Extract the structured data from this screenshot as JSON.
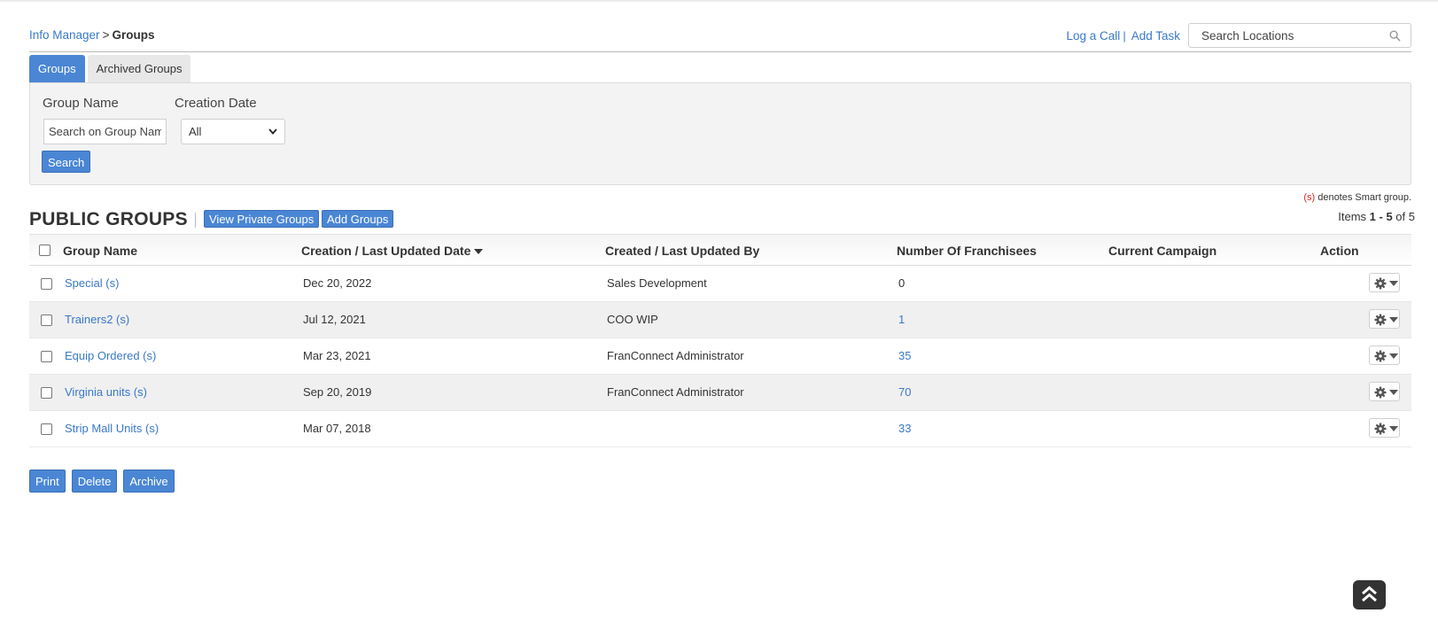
{
  "breadcrumb": {
    "parent": "Info Manager",
    "separator": ">",
    "current": "Groups"
  },
  "header_links": {
    "log_call": "Log a Call",
    "add_task": "Add Task",
    "pipe": "|"
  },
  "search_locations": {
    "placeholder": "Search Locations"
  },
  "tabs": [
    {
      "label": "Groups",
      "active": true
    },
    {
      "label": "Archived Groups",
      "active": false
    }
  ],
  "filters": {
    "group_name_label": "Group Name",
    "group_name_placeholder": "Search on Group Name",
    "creation_date_label": "Creation Date",
    "creation_date_value": "All",
    "search_button": "Search"
  },
  "smart_note": {
    "marker": "(s)",
    "text": " denotes Smart group."
  },
  "section": {
    "title": "PUBLIC GROUPS",
    "view_private_button": "View Private Groups",
    "add_groups_button": "Add Groups",
    "items_prefix": "Items ",
    "items_range": "1 - 5",
    "items_of": " of ",
    "items_total": "5"
  },
  "table": {
    "headers": {
      "group_name": "Group Name",
      "date": "Creation / Last Updated Date",
      "by": "Created / Last Updated By",
      "franchisees": "Number Of Franchisees",
      "campaign": "Current Campaign",
      "action": "Action"
    },
    "rows": [
      {
        "name": "Special (s)",
        "date": "Dec 20, 2022",
        "by": "Sales Development",
        "count": "0",
        "count_link": false,
        "campaign": ""
      },
      {
        "name": "Trainers2 (s)",
        "date": "Jul 12, 2021",
        "by": "COO WIP",
        "count": "1",
        "count_link": true,
        "campaign": ""
      },
      {
        "name": "Equip Ordered (s)",
        "date": "Mar 23, 2021",
        "by": "FranConnect Administrator",
        "count": "35",
        "count_link": true,
        "campaign": ""
      },
      {
        "name": "Virginia units (s)",
        "date": "Sep 20, 2019",
        "by": "FranConnect Administrator",
        "count": "70",
        "count_link": true,
        "campaign": ""
      },
      {
        "name": "Strip Mall Units (s)",
        "date": "Mar 07, 2018",
        "by": "",
        "count": "33",
        "count_link": true,
        "campaign": ""
      }
    ]
  },
  "bottom_buttons": {
    "print": "Print",
    "delete": "Delete",
    "archive": "Archive"
  },
  "icons": {
    "search": "search-icon",
    "gear": "gear-icon",
    "sort": "sort-desc-icon",
    "scroll_top": "double-chevron-up-icon"
  },
  "colors": {
    "accent": "#4a86d4",
    "link": "#3a78c9",
    "smart_marker": "#dd2222"
  }
}
